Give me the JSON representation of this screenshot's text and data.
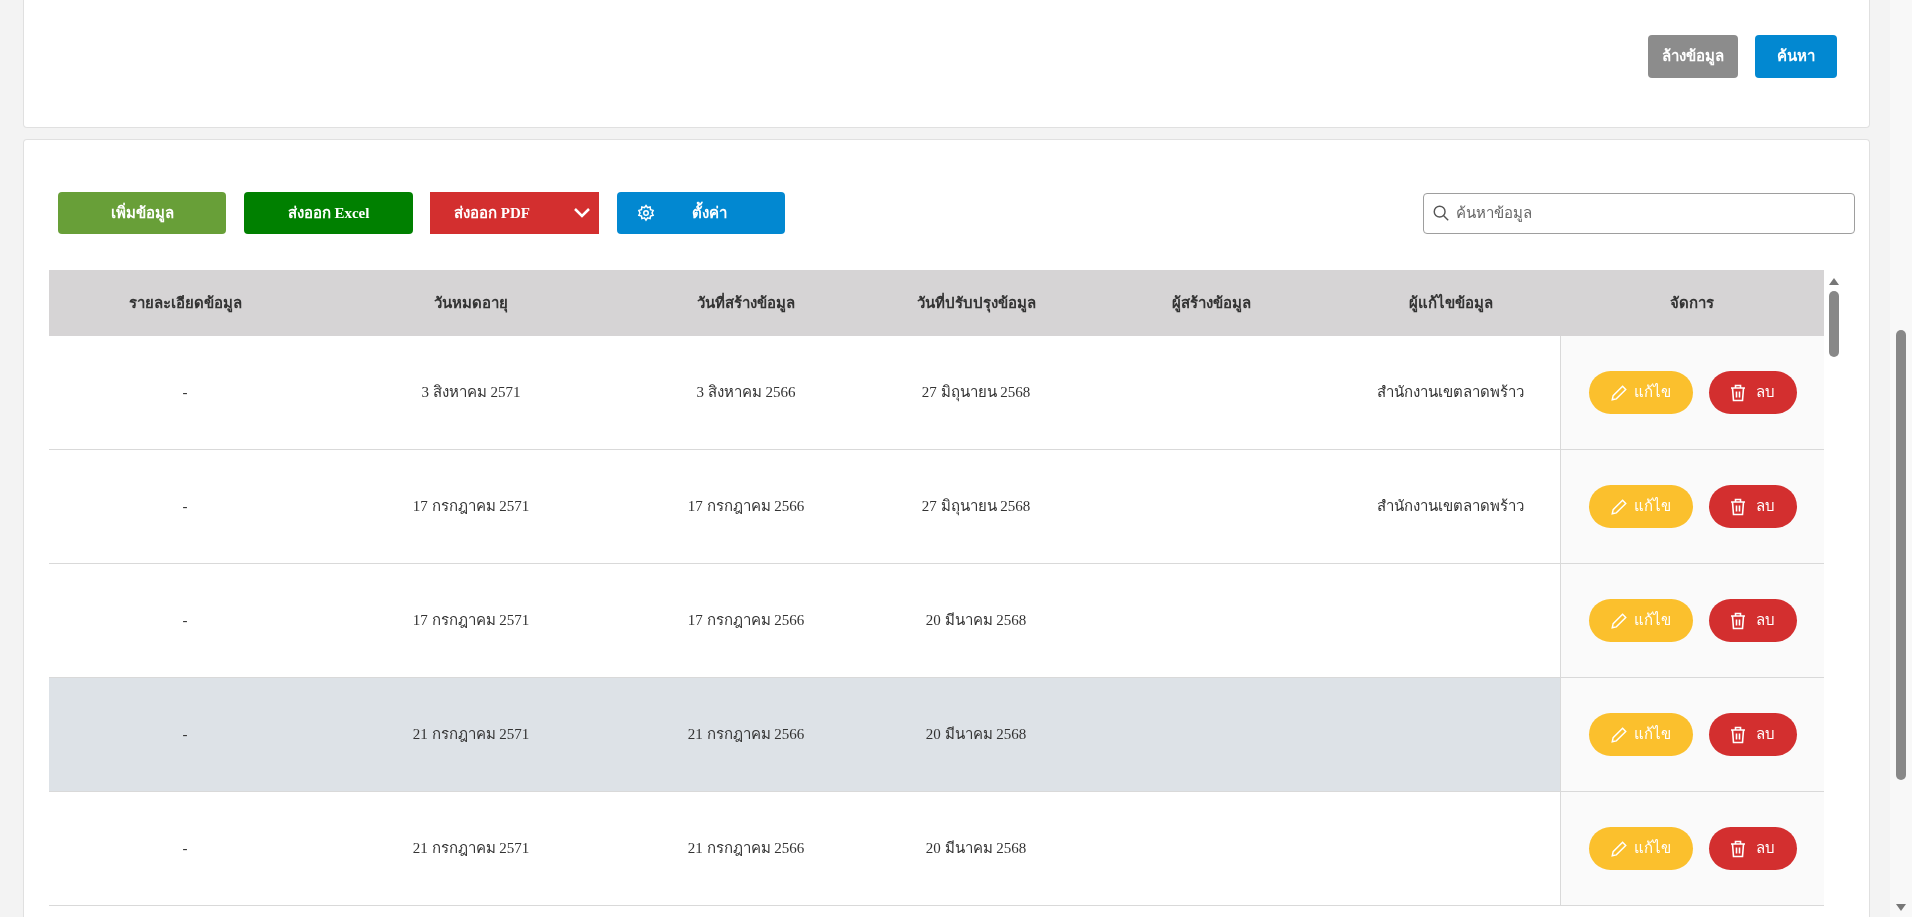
{
  "filter_actions": {
    "clear": "ล้างข้อมูล",
    "search": "ค้นหา"
  },
  "toolbar": {
    "add": "เพิ่มข้อมูล",
    "export_excel": "ส่งออก Excel",
    "export_pdf": "ส่งออก PDF",
    "settings": "ตั้งค่า"
  },
  "search": {
    "placeholder": "ค้นหาข้อมูล"
  },
  "table": {
    "columns": [
      "รายละเอียดข้อมูล",
      "วันหมดอายุ",
      "วันที่สร้างข้อมูล",
      "วันที่ปรับปรุงข้อมูล",
      "ผู้สร้างข้อมูล",
      "ผู้แก้ไขข้อมูล",
      "จัดการ"
    ],
    "rows": [
      {
        "cells": [
          "-",
          "3 สิงหาคม 2571",
          "3 สิงหาคม 2566",
          "27 มิถุนายน 2568",
          "",
          "สำนักงานเขตลาดพร้าว"
        ],
        "selected": false,
        "edit": "แก้ไข",
        "delete": "ลบ"
      },
      {
        "cells": [
          "-",
          "17 กรกฎาคม 2571",
          "17 กรกฎาคม 2566",
          "27 มิถุนายน 2568",
          "",
          "สำนักงานเขตลาดพร้าว"
        ],
        "selected": false,
        "edit": "แก้ไข",
        "delete": "ลบ"
      },
      {
        "cells": [
          "-",
          "17 กรกฎาคม 2571",
          "17 กรกฎาคม 2566",
          "20 มีนาคม 2568",
          "",
          ""
        ],
        "selected": false,
        "edit": "แก้ไข",
        "delete": "ลบ"
      },
      {
        "cells": [
          "-",
          "21 กรกฎาคม 2571",
          "21 กรกฎาคม 2566",
          "20 มีนาคม 2568",
          "",
          ""
        ],
        "selected": true,
        "edit": "แก้ไข",
        "delete": "ลบ"
      },
      {
        "cells": [
          "-",
          "21 กรกฎาคม 2571",
          "21 กรกฎาคม 2566",
          "20 มีนาคม 2568",
          "",
          ""
        ],
        "selected": false,
        "edit": "แก้ไข",
        "delete": "ลบ"
      }
    ]
  }
}
